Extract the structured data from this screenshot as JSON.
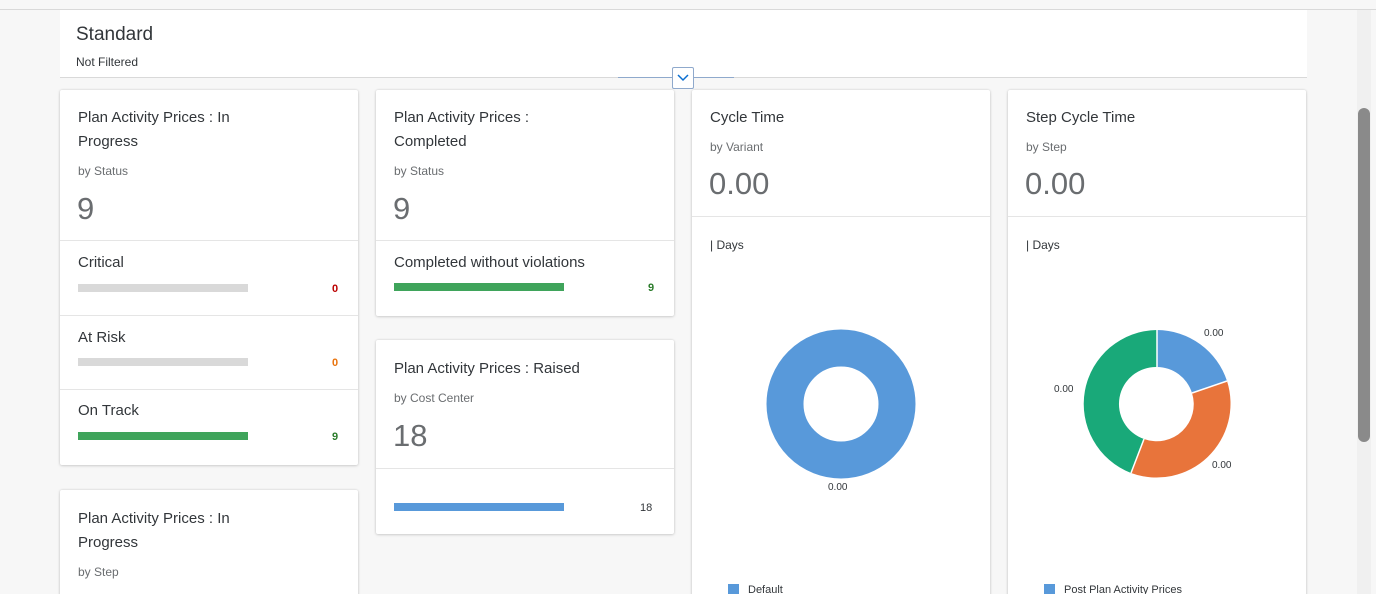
{
  "header": {
    "variant_title": "Standard",
    "filter_status": "Not Filtered"
  },
  "cards": {
    "in_progress_status": {
      "title_line1": "Plan Activity Prices : In",
      "title_line2": "Progress",
      "subtitle": "by Status",
      "kpi": "9",
      "rows": [
        {
          "label": "Critical",
          "value": "0",
          "fill": 0,
          "color": "#bb0000"
        },
        {
          "label": "At Risk",
          "value": "0",
          "fill": 0,
          "color": "#e9730c"
        },
        {
          "label": "On Track",
          "value": "9",
          "fill": 1,
          "color": "#2b7c2b"
        }
      ]
    },
    "completed": {
      "title_line1": "Plan Activity Prices :",
      "title_line2": "Completed",
      "subtitle": "by Status",
      "kpi": "9",
      "rows": [
        {
          "label": "Completed without violations",
          "value": "9",
          "fill": 1,
          "color": "#2b7c2b"
        }
      ]
    },
    "raised": {
      "title": "Plan Activity Prices : Raised",
      "subtitle": "by Cost Center",
      "kpi": "18",
      "bar_value": "18",
      "fill": 1
    },
    "in_progress_step": {
      "title_line1": "Plan Activity Prices : In",
      "title_line2": "Progress",
      "subtitle": "by Step"
    },
    "cycle_time": {
      "title": "Cycle Time",
      "subtitle": "by Variant",
      "kpi": "0.00",
      "unit": "| Days",
      "donut_label": "0.00",
      "legend": "Default"
    },
    "step_cycle_time": {
      "title": "Step Cycle Time",
      "subtitle": "by Step",
      "kpi": "0.00",
      "unit": "| Days",
      "labels": [
        "0.00",
        "0.00",
        "0.00"
      ],
      "legend": "Post Plan Activity Prices"
    }
  },
  "colors": {
    "green": "#3fa45b",
    "blue": "#5899da",
    "orange": "#e8743b",
    "teal": "#19a979",
    "track": "#d9d9d9"
  }
}
